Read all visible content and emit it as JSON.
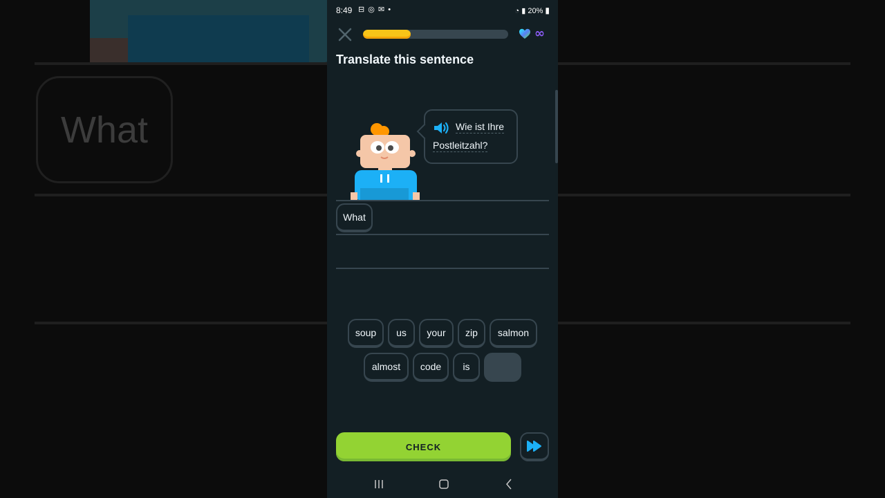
{
  "status_bar": {
    "time": "8:49",
    "left_icons": "⊟ ◎ ✉ •",
    "battery": "20%"
  },
  "lesson": {
    "progress": 0.33,
    "title": "Translate this sentence"
  },
  "prompt": {
    "line1": "Wie ist Ihre",
    "line2": "Postleitzahl?"
  },
  "answer": {
    "selected_words": [
      "What"
    ]
  },
  "word_bank": {
    "row1": [
      "soup",
      "us",
      "your",
      "zip",
      "salmon"
    ],
    "row2": [
      "almost",
      "code",
      "is"
    ]
  },
  "actions": {
    "check_label": "CHECK"
  },
  "background": {
    "blurred_word": "What"
  },
  "colors": {
    "phone_bg": "#131f24",
    "border": "#37464f",
    "progress_fill": "#f8c418",
    "check_button": "#93d333",
    "speaker": "#1cb0f6"
  }
}
